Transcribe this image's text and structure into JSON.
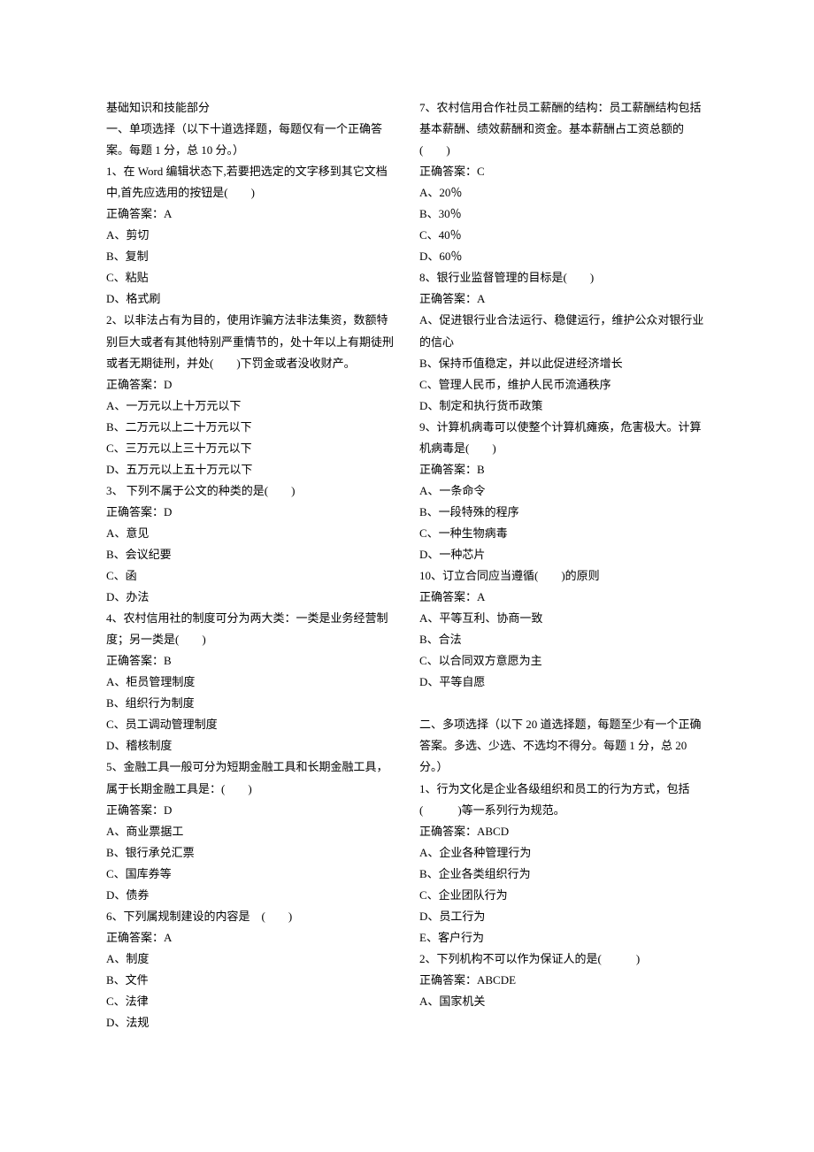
{
  "col1": [
    "基础知识和技能部分",
    "一、单项选择（以下十道选择题，每题仅有一个正确答案。每题 1 分，总 10 分。）",
    "1、在 Word 编辑状态下,若要把选定的文字移到其它文档中,首先应选用的按钮是(　　)",
    "正确答案：A",
    "A、剪切",
    "B、复制",
    "C、粘贴",
    "D、格式刷",
    "2、以非法占有为目的，使用诈骗方法非法集资，数额特别巨大或者有其他特别严重情节的，处十年以上有期徒刑或者无期徒刑，并处(　　)下罚金或者没收财产。",
    "正确答案：D",
    "A、一万元以上十万元以下",
    "B、二万元以上二十万元以下",
    "C、三万元以上三十万元以下",
    "D、五万元以上五十万元以下",
    "3、 下列不属于公文的种类的是(　　)",
    "正确答案：D",
    "A、意见",
    "B、会议纪要",
    "C、函",
    "D、办法",
    "4、农村信用社的制度可分为两大类：一类是业务经营制度；另一类是(　　)",
    "正确答案：B",
    "A、柜员管理制度",
    "B、组织行为制度",
    "C、员工调动管理制度",
    "D、稽核制度",
    "5、金融工具一般可分为短期金融工具和长期金融工具，属于长期金融工具是：(　　)",
    "正确答案：D",
    "A、商业票据工",
    "B、银行承兑汇票",
    "C、国库券等",
    "D、债券",
    "6、下列属规制建设的内容是　(　　)",
    "正确答案：A",
    "A、制度",
    "B、文件",
    "C、法律"
  ],
  "col2": [
    "D、法规",
    "7、农村信用合作社员工薪酬的结构：员工薪酬结构包括基本薪酬、绩效薪酬和资金。基本薪酬占工资总额的(　　)",
    "正确答案：C",
    "A、20％",
    "B、30％",
    "C、40％",
    "D、60％",
    "8、银行业监督管理的目标是(　　)",
    "正确答案：A",
    "A、促进银行业合法运行、稳健运行，维护公众对银行业的信心",
    "B、保持币值稳定，并以此促进经济增长",
    "C、管理人民币，维护人民币流通秩序",
    "D、制定和执行货币政策",
    "9、计算机病毒可以使整个计算机瘫痪，危害极大。计算机病毒是(　　)",
    "正确答案：B",
    "A、一条命令",
    "B、一段特殊的程序",
    "C、一种生物病毒",
    "D、一种芯片",
    "10、订立合同应当遵循(　　)的原则",
    "正确答案：A",
    "A、平等互利、协商一致",
    "B、合法",
    "C、以合同双方意愿为主",
    "D、平等自愿",
    "",
    "二、多项选择（以下 20 道选择题，每题至少有一个正确答案。多选、少选、不选均不得分。每题 1 分，总 20 分。）",
    "1、行为文化是企业各级组织和员工的行为方式，包括(　　　)等一系列行为规范。",
    "正确答案：ABCD",
    "A、企业各种管理行为",
    "B、企业各类组织行为",
    "C、企业团队行为",
    "D、员工行为",
    "E、客户行为",
    "2、下列机构不可以作为保证人的是(　　　)",
    "正确答案：ABCDE",
    "A、国家机关"
  ]
}
